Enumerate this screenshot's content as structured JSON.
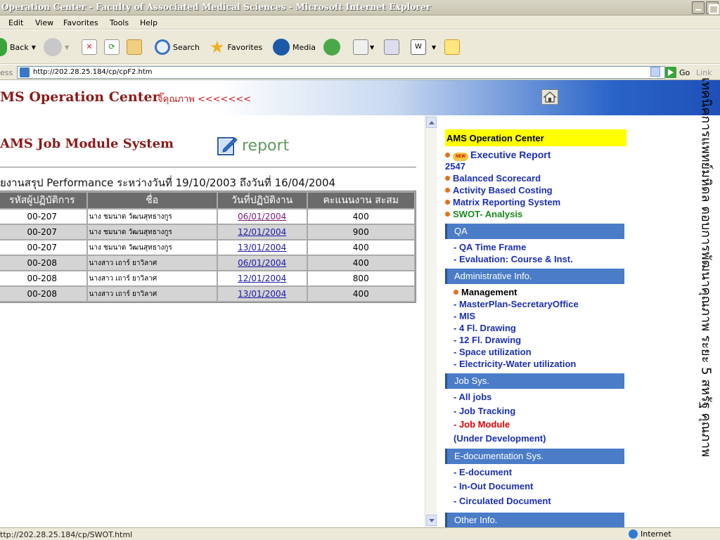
{
  "window": {
    "title": "Operation Center - Faculty of Associated Medical Sciences - Microsoft Internet Explorer"
  },
  "menubar": {
    "items": [
      "Edit",
      "View",
      "Favorites",
      "Tools",
      "Help"
    ]
  },
  "toolbar": {
    "back": "Back",
    "search": "Search",
    "favorites": "Favorites",
    "media": "Media"
  },
  "address": {
    "label": "ess",
    "url": "http://202.28.25.184/cp/cpF2.htm",
    "go": "Go",
    "links": "Link"
  },
  "banner": {
    "brand": "MS Operation Center",
    "tagline": "จิ๊คุณภาพ <<<<<<<"
  },
  "main": {
    "title": "AMS Job Module System",
    "report_label": "report",
    "summary": "ยงานสรุป Performance ระหว่างวันที่ 19/10/2003 ถึงวันที่ 16/04/2004",
    "columns": [
      "รหัสผู้ปฏิบัติการ",
      "ชื่อ",
      "วันที่ปฏิบัติงาน",
      "คะแนนงาน สะสม"
    ],
    "rows": [
      {
        "id": "00-207",
        "name": "นาง ชมนาด วัฒนสุทธางกูร",
        "date": "06/01/2004",
        "score": "400"
      },
      {
        "id": "00-207",
        "name": "นาง ชมนาด วัฒนสุทธางกูร",
        "date": "12/01/2004",
        "score": "900"
      },
      {
        "id": "00-207",
        "name": "นาง ชมนาด วัฒนสุทธางกูร",
        "date": "13/01/2004",
        "score": "400"
      },
      {
        "id": "00-208",
        "name": "นางสาว เถาร์ ยาวิลาศ",
        "date": "06/01/2004",
        "score": "400"
      },
      {
        "id": "00-208",
        "name": "นางสาว เถาร์ ยาวิลาศ",
        "date": "12/01/2004",
        "score": "800"
      },
      {
        "id": "00-208",
        "name": "นางสาว เถาร์ ยาวิลาศ",
        "date": "13/01/2004",
        "score": "400"
      }
    ]
  },
  "sidebar": {
    "header": "AMS Operation Center",
    "new_badge": "NEW",
    "exec_report": "Executive Report",
    "exec_year": "2547",
    "links": [
      "Balanced Scorecard",
      "Activity Based Costing",
      "Matrix Reporting System"
    ],
    "swot": "SWOT- Analysis",
    "qa": {
      "title": "QA",
      "items": [
        "- QA Time Frame",
        "- Evaluation: Course & Inst."
      ]
    },
    "admin": {
      "title": "Administrative Info.",
      "management": "Management",
      "items": [
        "- MasterPlan-SecretaryOffice",
        "- MIS",
        "- 4 Fl. Drawing",
        "- 12 Fl. Drawing",
        "- Space utilization",
        "- Electricity-Water utilization"
      ]
    },
    "jobsys": {
      "title": "Job Sys.",
      "items": [
        "- All jobs",
        "- Job Tracking"
      ],
      "job_module": "- Job Module",
      "under_dev": "(Under Development)"
    },
    "edoc": {
      "title": "E-documentation Sys.",
      "items": [
        "- E-document",
        "- In-Out Document",
        "- Circulated Document"
      ]
    },
    "other": "Other Info."
  },
  "vertical_text": "เทคนิคการแพทย์มหิดล ตอบการพัฒนาคุณภาพ ระยะ 5 สหรัฐ คุณภาพ",
  "status": {
    "text": "ttp://202.28.25.184/cp/SWOT.html",
    "zone": "Internet"
  }
}
